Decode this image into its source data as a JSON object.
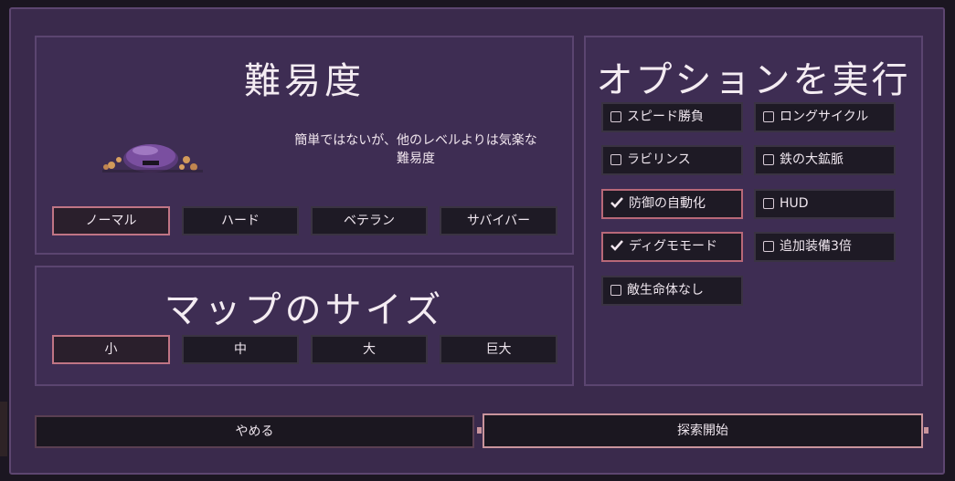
{
  "difficulty": {
    "title": "難易度",
    "description_line1": "簡単ではないが、他のレベルよりは気楽な",
    "description_line2": "難易度",
    "options": [
      "ノーマル",
      "ハード",
      "ベテラン",
      "サバイバー"
    ],
    "selected": "ノーマル"
  },
  "map_size": {
    "title": "マップのサイズ",
    "options": [
      "小",
      "中",
      "大",
      "巨大"
    ],
    "selected": "小"
  },
  "run_options": {
    "title": "オプションを実行",
    "items": [
      {
        "label": "スピード勝負",
        "checked": false
      },
      {
        "label": "ロングサイクル",
        "checked": false
      },
      {
        "label": "ラビリンス",
        "checked": false
      },
      {
        "label": "鉄の大鉱脈",
        "checked": false
      },
      {
        "label": "防御の自動化",
        "checked": true
      },
      {
        "label": "HUD",
        "checked": false
      },
      {
        "label": "ディグモモード",
        "checked": true
      },
      {
        "label": "追加装備3倍",
        "checked": false
      },
      {
        "label": "敵生命体なし",
        "checked": false
      }
    ]
  },
  "footer": {
    "cancel_label": "やめる",
    "start_label": "探索開始"
  },
  "colors": {
    "frame": "#3a2a4c",
    "panel": "#3e2d53",
    "button": "#1e1a25",
    "selected_border": "#c07585",
    "start_border": "#c9949c"
  },
  "icons": [
    "creature-sprite",
    "checkbox-empty-icon",
    "checkmark-icon"
  ]
}
